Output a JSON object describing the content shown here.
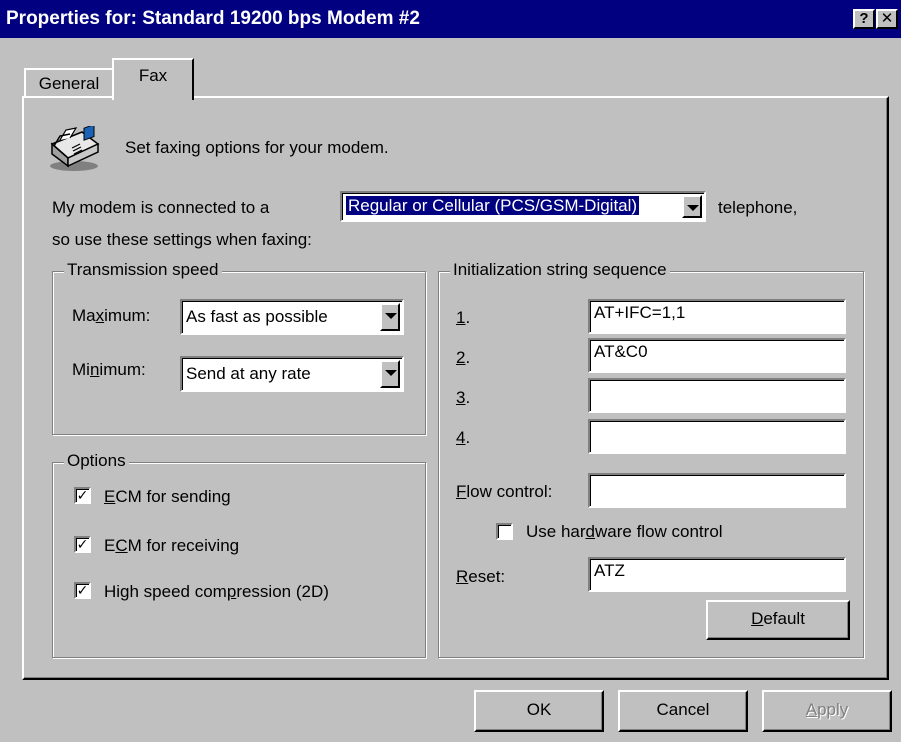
{
  "window": {
    "title": "Properties for: Standard 19200 bps Modem #2",
    "help_button": "?",
    "close_button": "✕"
  },
  "tabs": [
    {
      "label": "General",
      "selected": false
    },
    {
      "label": "Fax",
      "selected": true
    }
  ],
  "fax": {
    "intro": "Set faxing options for your modem.",
    "connected_prefix": "My modem is connected to a",
    "phone_type": "Regular or Cellular (PCS/GSM-Digital)",
    "connected_suffix": "telephone,",
    "settings_note": "so use these settings when faxing:"
  },
  "transmission": {
    "title": "Transmission speed",
    "maximum_label": "Maximum:",
    "maximum_value": "As fast as possible",
    "minimum_label": "Minimum:",
    "minimum_value": "Send at any rate"
  },
  "options": {
    "title": "Options",
    "items": [
      {
        "label": "ECM for sending",
        "checked": true
      },
      {
        "label": "ECM for receiving",
        "checked": true
      },
      {
        "label": "High speed compression (2D)",
        "checked": true
      }
    ]
  },
  "init": {
    "title": "Initialization string sequence",
    "rows": [
      {
        "label": "1.",
        "value": "AT+IFC=1,1"
      },
      {
        "label": "2.",
        "value": "AT&C0"
      },
      {
        "label": "3.",
        "value": ""
      },
      {
        "label": "4.",
        "value": ""
      }
    ],
    "flow_label": "Flow control:",
    "flow_value": "",
    "hw_flow_label": "Use hardware flow control",
    "hw_flow_checked": false,
    "reset_label": "Reset:",
    "reset_value": "ATZ",
    "default_button": "Default"
  },
  "buttons": {
    "ok": "OK",
    "cancel": "Cancel",
    "apply": "Apply"
  }
}
